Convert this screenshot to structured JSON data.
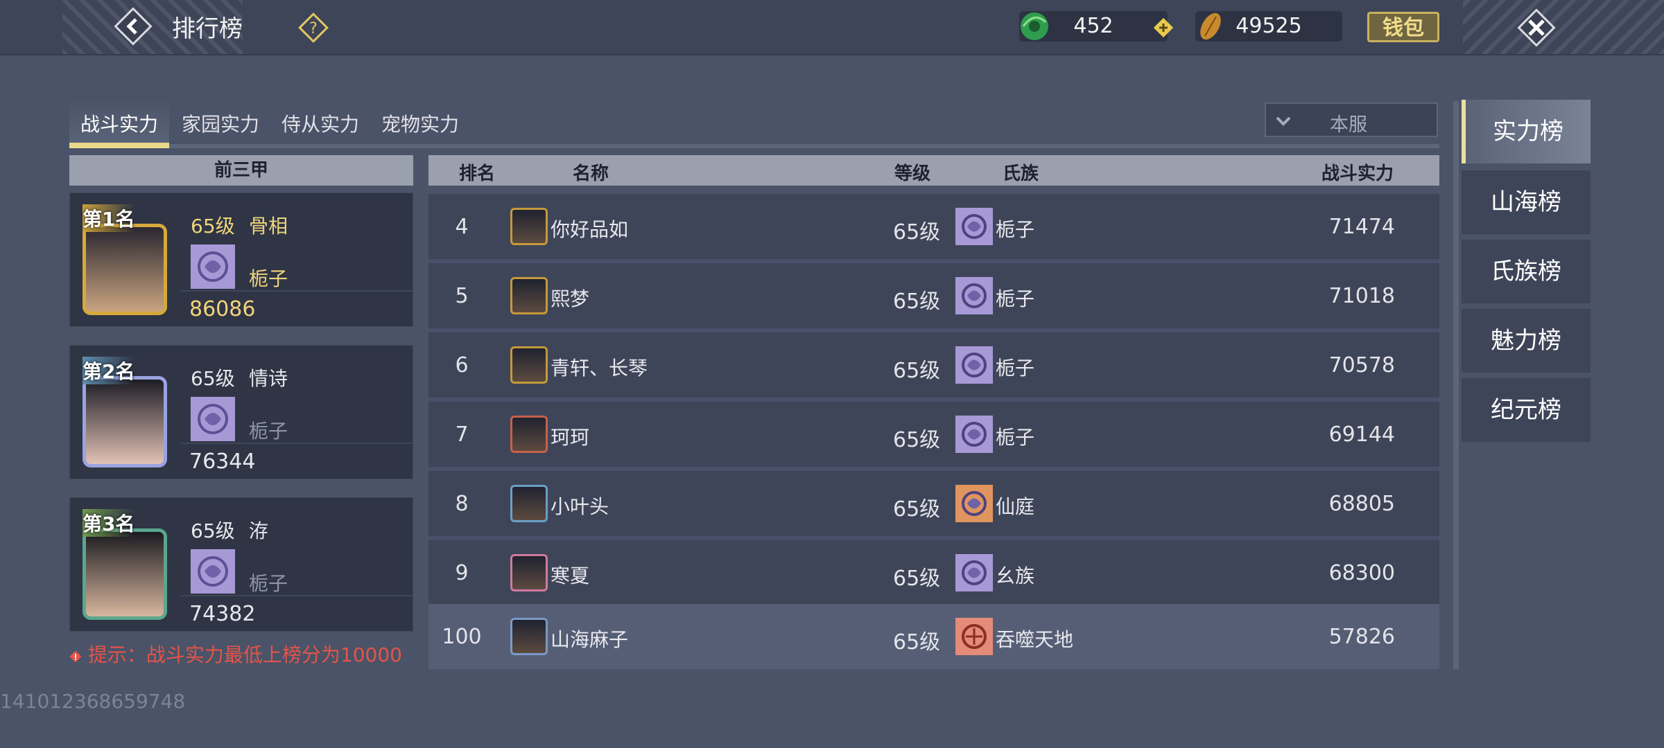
{
  "header": {
    "title": "排行榜",
    "jade_amount": "452",
    "coin_amount": "49525",
    "wallet_label": "钱包",
    "icons": [
      "back-arrow-icon",
      "help-icon",
      "jade-icon",
      "plus-icon",
      "coin-icon",
      "close-icon"
    ]
  },
  "tabs": [
    {
      "label": "战斗实力",
      "active": true
    },
    {
      "label": "家园实力",
      "active": false
    },
    {
      "label": "侍从实力",
      "active": false
    },
    {
      "label": "宠物实力",
      "active": false
    }
  ],
  "server_select": {
    "value": "本服"
  },
  "top3": {
    "header": "前三甲",
    "cards": [
      {
        "rank_label": "第1名",
        "level": "65级",
        "name": "骨相",
        "clan": "栀子",
        "power": "86086",
        "frame_color": "#d6a93a"
      },
      {
        "rank_label": "第2名",
        "level": "65级",
        "name": "情诗",
        "clan": "栀子",
        "power": "76344",
        "frame_color": "#9aa3e0"
      },
      {
        "rank_label": "第3名",
        "level": "65级",
        "name": "洊",
        "clan": "栀子",
        "power": "74382",
        "frame_color": "#5aa78d"
      }
    ]
  },
  "tip": "提示：战斗实力最低上榜分为10000",
  "list": {
    "headers": {
      "rank": "排名",
      "name": "名称",
      "level": "等级",
      "clan": "氏族",
      "power": "战斗实力"
    },
    "rows": [
      {
        "rank": "4",
        "name": "你好品如",
        "level": "65级",
        "clan": "栀子",
        "power": "71474",
        "clan_color": "#a799d6"
      },
      {
        "rank": "5",
        "name": "熙梦",
        "level": "65级",
        "clan": "栀子",
        "power": "71018",
        "clan_color": "#a799d6"
      },
      {
        "rank": "6",
        "name": "青轩、长琴",
        "level": "65级",
        "clan": "栀子",
        "power": "70578",
        "clan_color": "#a799d6"
      },
      {
        "rank": "7",
        "name": "珂珂",
        "level": "65级",
        "clan": "栀子",
        "power": "69144",
        "clan_color": "#a799d6"
      },
      {
        "rank": "8",
        "name": "小叶头",
        "level": "65级",
        "clan": "仙庭",
        "power": "68805",
        "clan_color": "#e0955e"
      },
      {
        "rank": "9",
        "name": "寒夏",
        "level": "65级",
        "clan": "幺族",
        "power": "68300",
        "clan_color": "#a799d6"
      }
    ],
    "self_row": {
      "rank": "100",
      "name": "山海麻子",
      "level": "65级",
      "clan": "吞噬天地",
      "power": "57826",
      "clan_color": "#e58b7a"
    }
  },
  "side_tabs": [
    {
      "label": "实力榜",
      "active": true
    },
    {
      "label": "山海榜",
      "active": false
    },
    {
      "label": "氏族榜",
      "active": false
    },
    {
      "label": "魅力榜",
      "active": false
    },
    {
      "label": "纪元榜",
      "active": false
    }
  ],
  "footer_id": "141012368659748",
  "colors": {
    "accent_gold": "#e9d98c",
    "tip_red": "#e55448",
    "clan_purple": "#a799d6"
  }
}
